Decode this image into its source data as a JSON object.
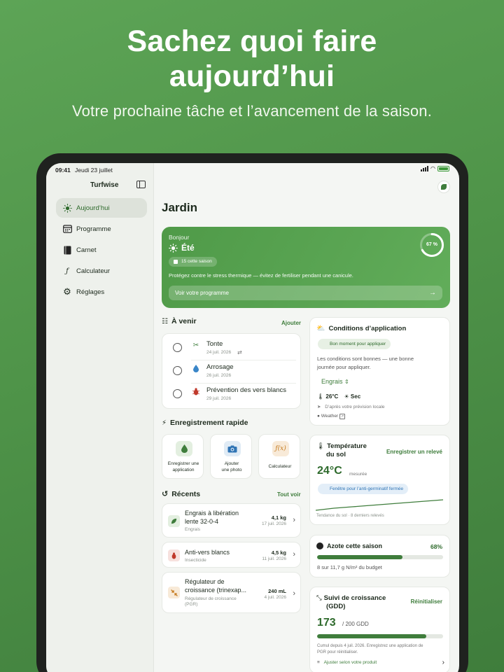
{
  "hero": {
    "title_line1": "Sachez quoi faire",
    "title_line2": "aujourd’hui",
    "subtitle": "Votre prochaine tâche et l’avancement de la saison."
  },
  "status_bar": {
    "time": "09:41",
    "date": "Jeudi 23 juillet"
  },
  "sidebar": {
    "title": "Turfwise",
    "items": [
      {
        "label": "Aujourd’hui",
        "icon": "sun-icon",
        "active": true
      },
      {
        "label": "Programme",
        "icon": "calendar-icon",
        "active": false
      },
      {
        "label": "Carnet",
        "icon": "book-icon",
        "active": false
      },
      {
        "label": "Calculateur",
        "icon": "function-icon",
        "active": false
      },
      {
        "label": "Réglages",
        "icon": "gear-icon",
        "active": false
      }
    ]
  },
  "main": {
    "title": "Jardin",
    "summary": {
      "greeting": "Bonjour",
      "season": "Été",
      "badge": "15 cette saison",
      "message": "Protégez contre le stress thermique — évitez de fertiliser pendant une canicule.",
      "button": "Voir votre programme",
      "progress_label": "67 %",
      "progress": 0.67
    },
    "upcoming": {
      "title": "À venir",
      "action": "Ajouter",
      "tasks": [
        {
          "name": "Tonte",
          "date": "24 juil. 2026",
          "icon": "scissors-icon",
          "repeat": true
        },
        {
          "name": "Arrosage",
          "date": "26 juil. 2026",
          "icon": "water-drop-icon",
          "repeat": false
        },
        {
          "name": "Prévention des vers blancs",
          "date": "29 juil. 2026",
          "icon": "bug-icon",
          "repeat": false
        }
      ]
    },
    "quick": {
      "title": "Enregistrement rapide",
      "actions": [
        {
          "label_line1": "Enregistrer une",
          "label_line2": "application"
        },
        {
          "label_line1": "Ajouter",
          "label_line2": "une photo"
        },
        {
          "label_line1": "Calculateur",
          "label_line2": ""
        }
      ]
    },
    "recent": {
      "title": "Récents",
      "action": "Tout voir",
      "items": [
        {
          "name_line1": "Engrais à libération",
          "name_line2": "lente 32-0-4",
          "name_line3": "",
          "type": "Engrais",
          "type_line2": "",
          "qty": "4,1 kg",
          "date": "17 juil. 2026"
        },
        {
          "name_line1": "Anti-vers blancs",
          "name_line2": "",
          "name_line3": "",
          "type": "Insecticide",
          "type_line2": "",
          "qty": "4,5 kg",
          "date": "11 juil. 2026"
        },
        {
          "name_line1": "Régulateur de",
          "name_line2": "croissance (trinexap...",
          "name_line3": "",
          "type": "Régulateur de croissance",
          "type_line2": "(PGR)",
          "qty": "240 mL",
          "date": "4 juil. 2026"
        }
      ]
    },
    "conditions": {
      "title": "Conditions d’application",
      "pill": "Bon moment pour appliquer",
      "text_line1": "Les conditions sont bonnes — une bonne",
      "text_line2": "journée pour appliquer.",
      "select": "Engrais",
      "temp": "26°C",
      "weather": "Sec",
      "source": "D’après votre prévision locale",
      "provider": "Weather"
    },
    "soil": {
      "title_line1": "Température",
      "title_line2": "du sol",
      "action": "Enregistrer un relevé",
      "value": "24°C",
      "unit": "mesurée",
      "pill": "Fenêtre pour l’anti-germinatif fermée",
      "trend": "Tendance du sol · 8 derniers relevés"
    },
    "nitrogen": {
      "title": "Azote cette saison",
      "percent": "68%",
      "fraction": 0.68,
      "detail": "8 sur 11,7 g N/m² du budget"
    },
    "gdd": {
      "title_line1": "Suivi de croissance",
      "title_line2": "(GDD)",
      "action": "Réinitialiser",
      "value": "173",
      "target": "/ 200 GDD",
      "fraction": 0.865,
      "note_line1": "Cumul depuis 4 juil. 2026. Enregistrez une application de",
      "note_line2": "PGR pour réinitialiser.",
      "link": "Ajuster selon votre produit"
    }
  },
  "colors": {
    "accent": "#3f7d3c",
    "hero_green": "#5aa553",
    "background": "#4f9449"
  }
}
